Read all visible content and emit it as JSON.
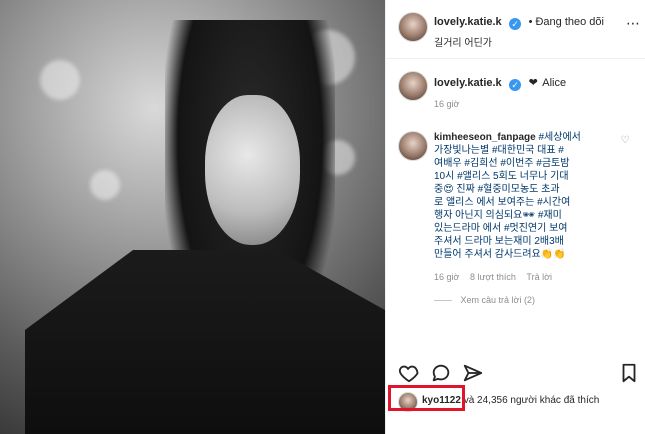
{
  "header": {
    "username": "lovely.katie.k",
    "follow_state": "• Đang theo dõi",
    "location": "길거리 어딘가",
    "more_icon": "more-icon"
  },
  "caption": {
    "username": "lovely.katie.k",
    "text": "Alice",
    "time": "16 giờ",
    "heart_icon": "black-heart-icon"
  },
  "comment": {
    "username": "kimheeseon_fanpage",
    "lines": [
      "#세상에서",
      "가장빛나는별 #대한민국 대표 #",
      "여배우 #김희선 #이번주 #금토밤",
      "10시 #앨리스 5회도 너무나 기대",
      "중😍 진짜 #혈중미모농도 초과",
      "로 앨리스 에서 보여주는 #시간여",
      "행자 아닌지 의심되요🕶 #재미",
      "있는드라마 에서 #멋진연기 보여",
      "주셔서 드라마 보는재미 2배3배",
      "만들어 주셔서 감사드려요👏👏"
    ],
    "time": "16 giờ",
    "likes": "8 lượt thích",
    "reply": "Trả lời",
    "view_replies": "Xem câu trả lời (2)"
  },
  "actions": {
    "like_icon": "heart-outline-icon",
    "comment_icon": "comment-icon",
    "share_icon": "share-icon",
    "save_icon": "bookmark-icon"
  },
  "likes_bar": {
    "liker": "kyo1122",
    "rest": "và 24,356 người khác đã thích"
  },
  "colors": {
    "verified": "#3897f0",
    "highlight": "#e0152b",
    "hashtag": "#00376b"
  }
}
